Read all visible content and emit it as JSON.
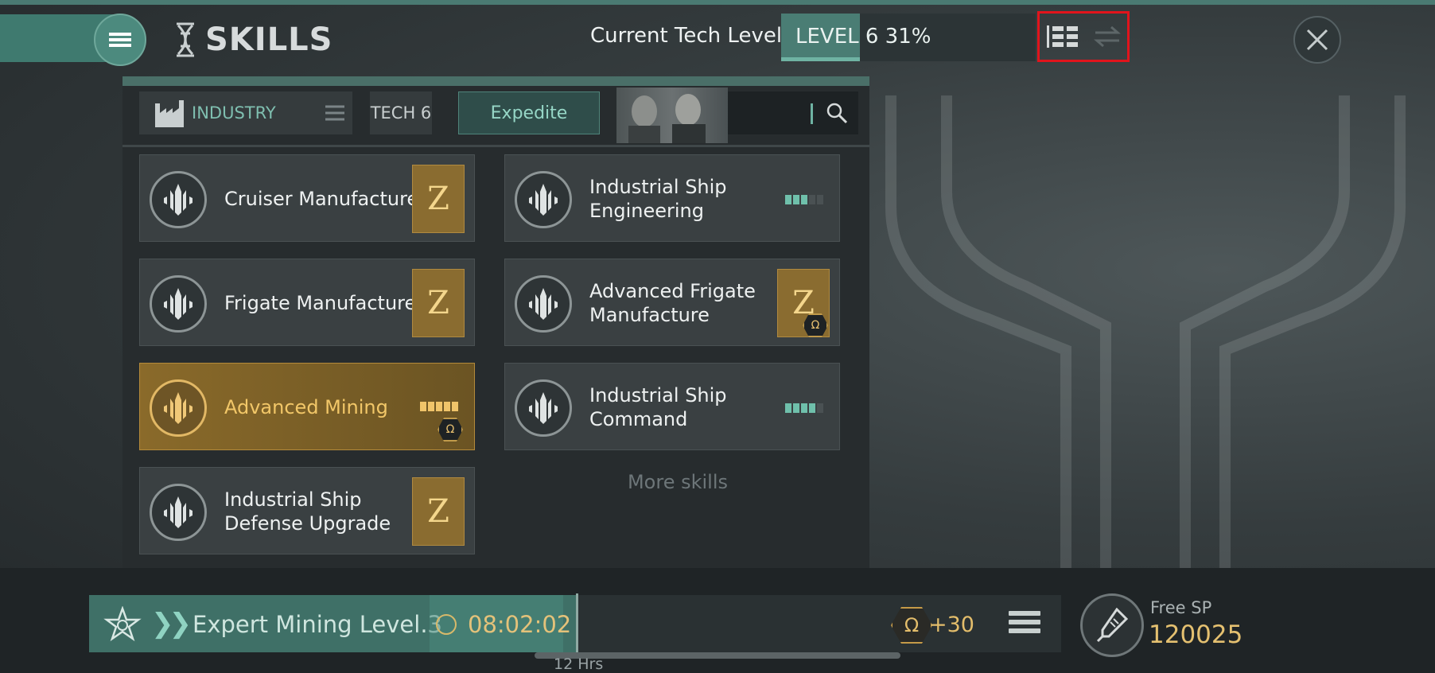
{
  "header": {
    "title": "SKILLS",
    "tech_label": "Current Tech Level",
    "tech_level_text": "LEVEL 6 31%",
    "tech_progress": 0.31
  },
  "filters": {
    "category": "INDUSTRY",
    "tech": "TECH 6",
    "expedite": "Expedite"
  },
  "skills": [
    {
      "name_lines": [
        "Cruiser Manufacture"
      ],
      "state": "locked"
    },
    {
      "name_lines": [
        "Industrial Ship",
        "Engineering"
      ],
      "state": "progress",
      "level": 3
    },
    {
      "name_lines": [
        "Frigate Manufacture"
      ],
      "state": "locked"
    },
    {
      "name_lines": [
        "Advanced Frigate",
        "Manufacture"
      ],
      "state": "locked-omega"
    },
    {
      "name_lines": [
        "Advanced Mining"
      ],
      "state": "active",
      "level": 5
    },
    {
      "name_lines": [
        "Industrial Ship",
        "Command"
      ],
      "state": "progress",
      "level": 4
    },
    {
      "name_lines": [
        "Industrial Ship",
        "Defense Upgrade"
      ],
      "state": "locked"
    }
  ],
  "badge_glyph": "Z",
  "omega_glyph": "Ω",
  "more_skills": "More skills",
  "queue": {
    "name": "Expert Mining Level.3",
    "time": "08:02:02",
    "omega_bonus": "+30",
    "scale_label": "12 Hrs"
  },
  "free_sp": {
    "label": "Free SP",
    "value": "120025"
  },
  "colors": {
    "accent": "#4a7d74",
    "gold": "#e4c070",
    "highlight_box": "#e1141c"
  }
}
